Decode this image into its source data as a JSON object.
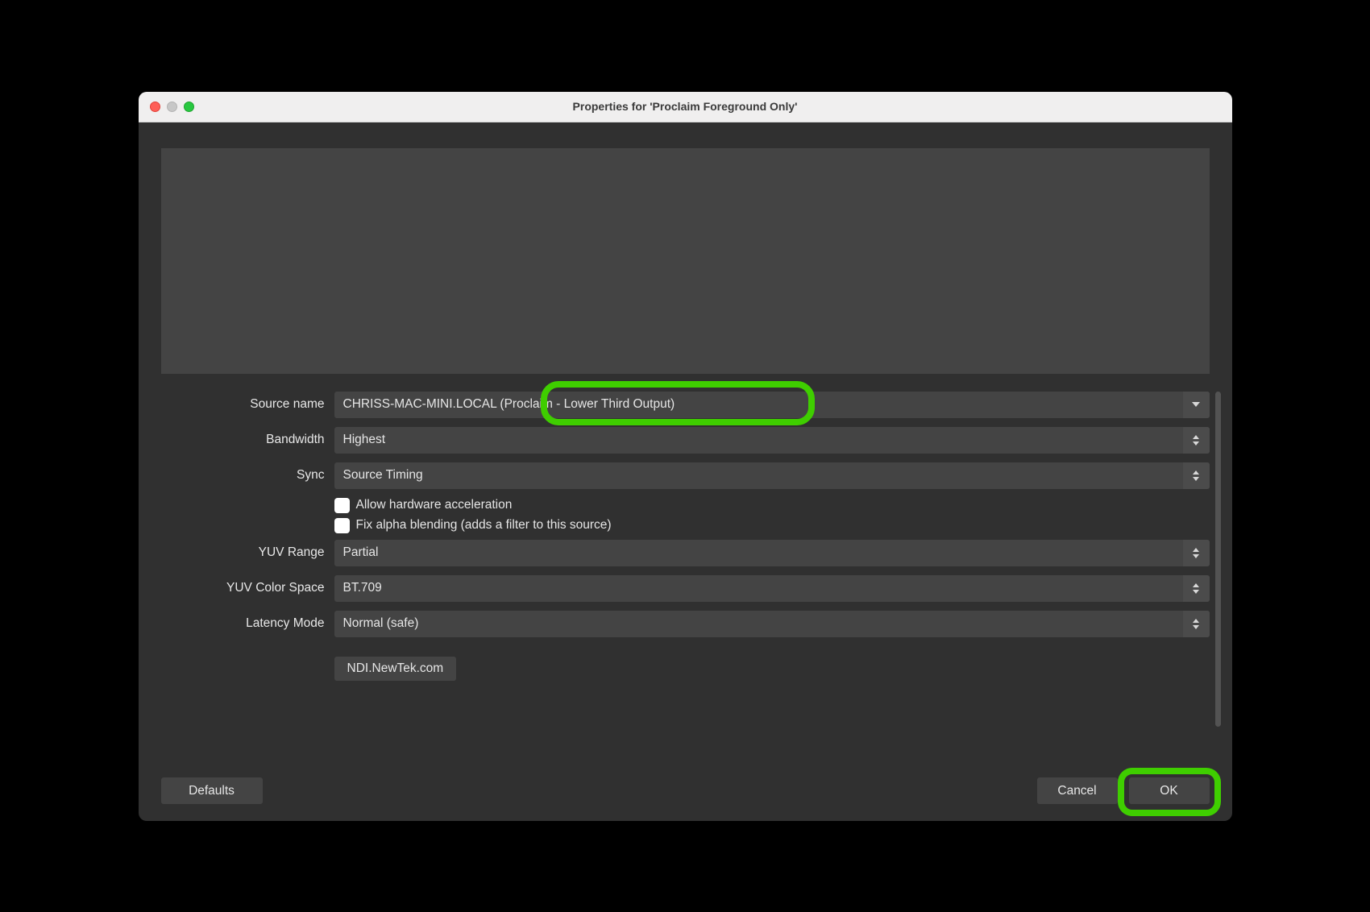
{
  "window": {
    "title": "Properties for 'Proclaim Foreground Only'"
  },
  "form": {
    "source_name": {
      "label": "Source name",
      "value": "CHRISS-MAC-MINI.LOCAL (Proclaim - Lower Third Output)"
    },
    "bandwidth": {
      "label": "Bandwidth",
      "value": "Highest"
    },
    "sync": {
      "label": "Sync",
      "value": "Source Timing"
    },
    "allow_hw": {
      "label": "Allow hardware acceleration"
    },
    "fix_alpha": {
      "label": "Fix alpha blending (adds a filter to this source)"
    },
    "yuv_range": {
      "label": "YUV Range",
      "value": "Partial"
    },
    "yuv_space": {
      "label": "YUV Color Space",
      "value": "BT.709"
    },
    "latency": {
      "label": "Latency Mode",
      "value": "Normal (safe)"
    },
    "link": {
      "label": "NDI.NewTek.com"
    }
  },
  "footer": {
    "defaults": "Defaults",
    "cancel": "Cancel",
    "ok": "OK"
  }
}
